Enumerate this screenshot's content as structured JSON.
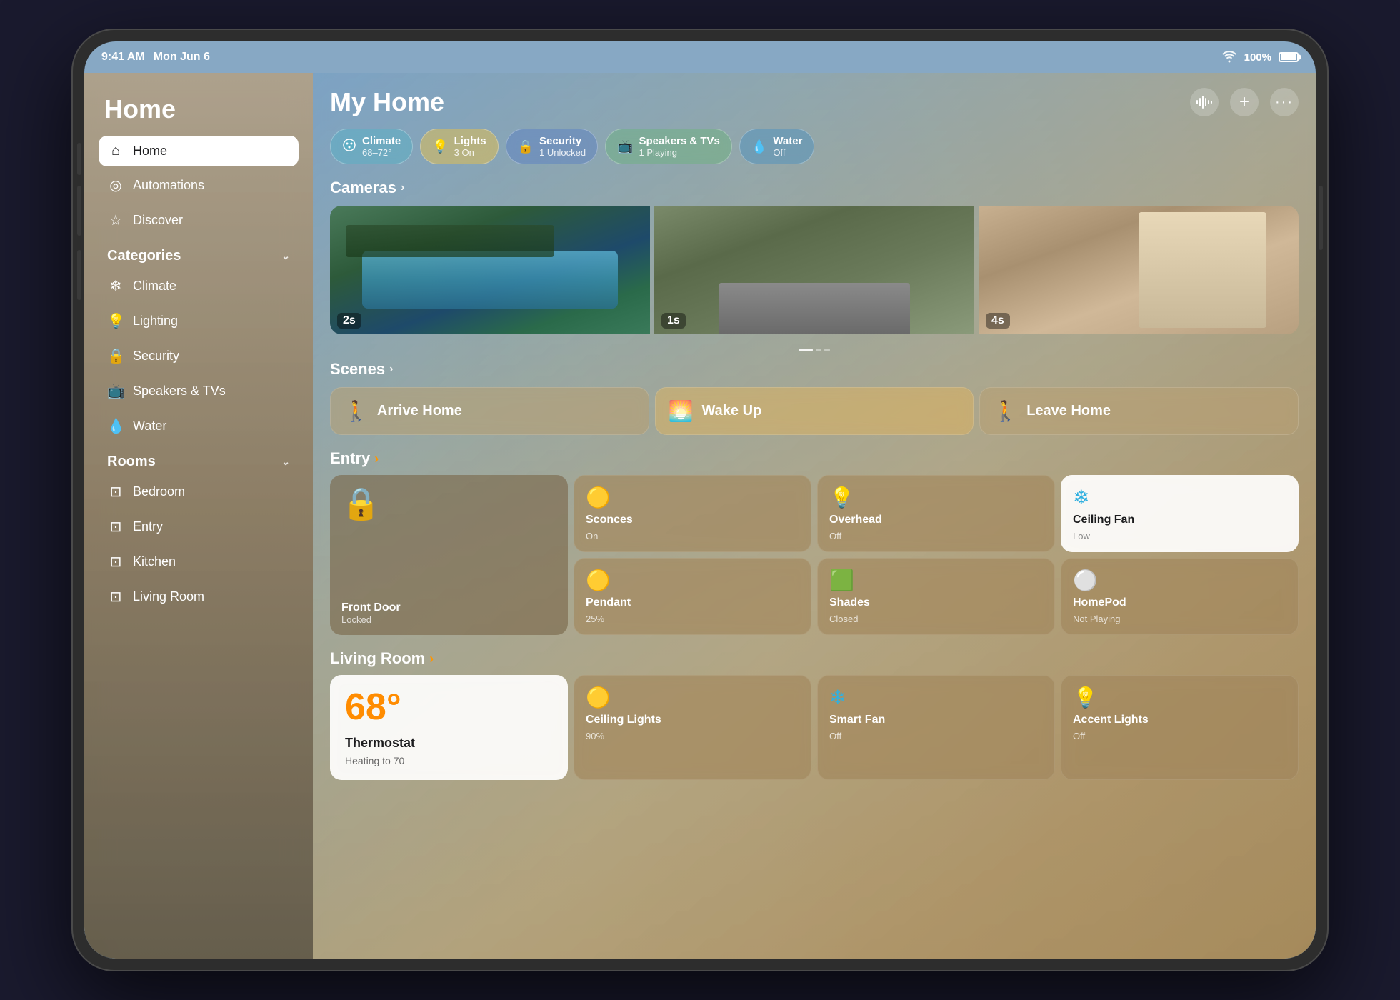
{
  "statusBar": {
    "time": "9:41 AM",
    "date": "Mon Jun 6",
    "wifi": "WiFi",
    "battery": "100%"
  },
  "sidebar": {
    "title": "Home",
    "navItems": [
      {
        "id": "home",
        "label": "Home",
        "icon": "⌂",
        "active": true
      },
      {
        "id": "automations",
        "label": "Automations",
        "icon": "○"
      },
      {
        "id": "discover",
        "label": "Discover",
        "icon": "☆"
      }
    ],
    "categoriesTitle": "Categories",
    "categories": [
      {
        "id": "climate",
        "label": "Climate",
        "icon": "❄"
      },
      {
        "id": "lighting",
        "label": "Lighting",
        "icon": "💡"
      },
      {
        "id": "security",
        "label": "Security",
        "icon": "🔒"
      },
      {
        "id": "speakers",
        "label": "Speakers & TVs",
        "icon": "📺"
      },
      {
        "id": "water",
        "label": "Water",
        "icon": "💧"
      }
    ],
    "roomsTitle": "Rooms",
    "rooms": [
      {
        "id": "bedroom",
        "label": "Bedroom",
        "icon": "⊡"
      },
      {
        "id": "entry",
        "label": "Entry",
        "icon": "⊡"
      },
      {
        "id": "kitchen",
        "label": "Kitchen",
        "icon": "⊡"
      },
      {
        "id": "livingroom",
        "label": "Living Room",
        "icon": "⊡"
      }
    ]
  },
  "header": {
    "title": "My Home",
    "actions": [
      "waveform",
      "plus",
      "ellipsis"
    ]
  },
  "pills": [
    {
      "id": "climate",
      "icon": "❄",
      "label": "Climate",
      "sub": "68–72°",
      "color": "climate"
    },
    {
      "id": "lights",
      "icon": "💡",
      "label": "Lights",
      "sub": "3 On",
      "color": "lights"
    },
    {
      "id": "security",
      "icon": "🔒",
      "label": "Security",
      "sub": "1 Unlocked",
      "color": "security"
    },
    {
      "id": "speakers",
      "icon": "📺",
      "label": "Speakers & TVs",
      "sub": "1 Playing",
      "color": "speakers"
    },
    {
      "id": "water",
      "icon": "💧",
      "label": "Water",
      "sub": "Off",
      "color": "water"
    }
  ],
  "cameras": {
    "sectionTitle": "Cameras",
    "items": [
      {
        "id": "pool",
        "timestamp": "2s",
        "type": "pool"
      },
      {
        "id": "garage",
        "timestamp": "1s",
        "type": "garage"
      },
      {
        "id": "bedroom",
        "timestamp": "4s",
        "type": "bedroom"
      }
    ]
  },
  "scenes": {
    "sectionTitle": "Scenes",
    "items": [
      {
        "id": "arrive",
        "label": "Arrive Home",
        "icon": "🚶",
        "style": "normal"
      },
      {
        "id": "wakeup",
        "label": "Wake Up",
        "icon": "🌅",
        "style": "wakeup"
      },
      {
        "id": "leave",
        "label": "Leave Home",
        "icon": "🚶",
        "style": "normal"
      }
    ]
  },
  "entryRoom": {
    "title": "Entry",
    "devices": [
      {
        "id": "front-door",
        "name": "Front Door",
        "status": "Locked",
        "icon": "🔒",
        "style": "lock",
        "iconColor": "teal"
      },
      {
        "id": "sconces",
        "name": "Sconces",
        "status": "On",
        "icon": "💛",
        "style": "dark"
      },
      {
        "id": "overhead",
        "name": "Overhead",
        "status": "Off",
        "icon": "💡",
        "style": "dark"
      },
      {
        "id": "ceiling-fan",
        "name": "Ceiling Fan",
        "status": "Low",
        "icon": "❄",
        "style": "white"
      },
      {
        "id": "pendant",
        "name": "Pendant",
        "status": "25%",
        "icon": "💛",
        "style": "dark"
      },
      {
        "id": "shades",
        "name": "Shades",
        "status": "Closed",
        "icon": "🟩",
        "style": "dark"
      },
      {
        "id": "homepod",
        "name": "HomePod",
        "status": "Not Playing",
        "icon": "⚪",
        "style": "dark"
      }
    ]
  },
  "livingRoom": {
    "title": "Living Room",
    "devices": [
      {
        "id": "thermostat",
        "name": "Thermostat",
        "status": "Heating to 70",
        "temp": "68°",
        "style": "thermostat"
      },
      {
        "id": "ceiling-lights",
        "name": "Ceiling Lights",
        "status": "90%",
        "icon": "💛",
        "style": "dark"
      },
      {
        "id": "smart-fan",
        "name": "Smart Fan",
        "status": "Off",
        "icon": "❄",
        "style": "dark"
      },
      {
        "id": "accent-lights",
        "name": "Accent Lights",
        "status": "Off",
        "icon": "💡",
        "style": "dark"
      }
    ]
  }
}
